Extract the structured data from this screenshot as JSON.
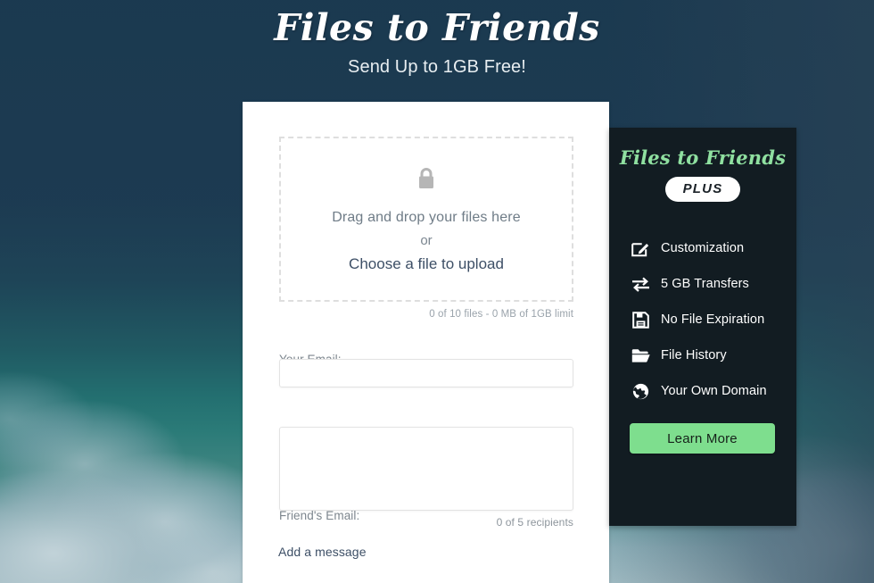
{
  "header": {
    "title": "Files to Friends",
    "tagline": "Send Up to 1GB Free!"
  },
  "upload_card": {
    "dropzone": {
      "icon": "lock-icon",
      "line1": "Drag and drop your files here",
      "divider": "or",
      "choose_link": "Choose a file to upload"
    },
    "file_limit_status": "0 of 10 files - 0 MB of 1GB limit",
    "your_email": {
      "label": "Your Email:",
      "value": "",
      "placeholder": ""
    },
    "friend_email": {
      "label": "Friend's Email:",
      "value": "",
      "placeholder": ""
    },
    "recipients_status": "0 of 5 recipients",
    "add_message_link": "Add a message"
  },
  "plus_panel": {
    "logo": "Files to Friends",
    "badge": "PLUS",
    "features": [
      {
        "icon": "edit-square-icon",
        "label": "Customization"
      },
      {
        "icon": "exchange-arrows-icon",
        "label": "5 GB Transfers"
      },
      {
        "icon": "floppy-disk-icon",
        "label": "No File Expiration"
      },
      {
        "icon": "folder-icon",
        "label": "File History"
      },
      {
        "icon": "globe-icon",
        "label": "Your Own Domain"
      }
    ],
    "cta_label": "Learn More"
  },
  "colors": {
    "background_top": "#1d3b52",
    "background_bottom": "#a7c0c7",
    "panel_dark": "#121c22",
    "accent_green": "#8fe0a0",
    "button_green": "#7ede8e",
    "link_slate": "#3d4f66",
    "card_white": "#ffffff"
  }
}
